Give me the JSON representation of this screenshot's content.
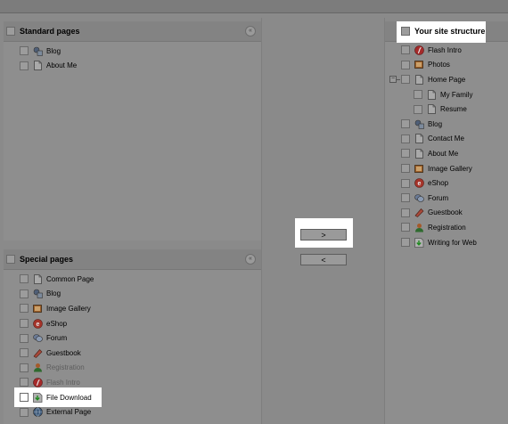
{
  "standard_pages": {
    "title": "Standard pages",
    "items": [
      {
        "label": "Blog",
        "icon": "blog-icon"
      },
      {
        "label": "About Me",
        "icon": "page-icon"
      }
    ]
  },
  "special_pages": {
    "title": "Special pages",
    "items": [
      {
        "label": "Common Page",
        "icon": "page-icon",
        "disabled": false
      },
      {
        "label": "Blog",
        "icon": "blog-icon",
        "disabled": false
      },
      {
        "label": "Image Gallery",
        "icon": "image-gallery-icon",
        "disabled": false
      },
      {
        "label": "eShop",
        "icon": "eshop-icon",
        "disabled": false
      },
      {
        "label": "Forum",
        "icon": "forum-icon",
        "disabled": false
      },
      {
        "label": "Guestbook",
        "icon": "guestbook-icon",
        "disabled": false
      },
      {
        "label": "Registration",
        "icon": "registration-icon",
        "disabled": true
      },
      {
        "label": "Flash Intro",
        "icon": "flash-icon",
        "disabled": true
      },
      {
        "label": "File Download",
        "icon": "file-download-icon",
        "disabled": false,
        "highlighted": true
      },
      {
        "label": "External Page",
        "icon": "external-page-icon",
        "disabled": false
      }
    ]
  },
  "site_structure": {
    "title": "Your site structure",
    "items": [
      {
        "label": "Flash Intro",
        "icon": "flash-icon",
        "level": 0
      },
      {
        "label": "Photos",
        "icon": "image-gallery-icon",
        "level": 0
      },
      {
        "label": "Home Page",
        "icon": "page-icon",
        "level": 0,
        "expanded": true
      },
      {
        "label": "My Family",
        "icon": "page-icon",
        "level": 1
      },
      {
        "label": "Resume",
        "icon": "page-icon",
        "level": 1
      },
      {
        "label": "Blog",
        "icon": "blog-icon",
        "level": 0
      },
      {
        "label": "Contact Me",
        "icon": "page-icon",
        "level": 0
      },
      {
        "label": "About Me",
        "icon": "page-icon",
        "level": 0
      },
      {
        "label": "Image Gallery",
        "icon": "image-gallery-icon",
        "level": 0
      },
      {
        "label": "eShop",
        "icon": "eshop-icon",
        "level": 0
      },
      {
        "label": "Forum",
        "icon": "forum-icon",
        "level": 0
      },
      {
        "label": "Guestbook",
        "icon": "guestbook-icon",
        "level": 0
      },
      {
        "label": "Registration",
        "icon": "registration-icon",
        "level": 0
      },
      {
        "label": "Writing for Web",
        "icon": "file-download-icon",
        "level": 0
      }
    ]
  },
  "buttons": {
    "add_label": ">",
    "remove_label": "<"
  },
  "tree": {
    "collapse_symbol": "−"
  },
  "collapse_symbol": "«"
}
